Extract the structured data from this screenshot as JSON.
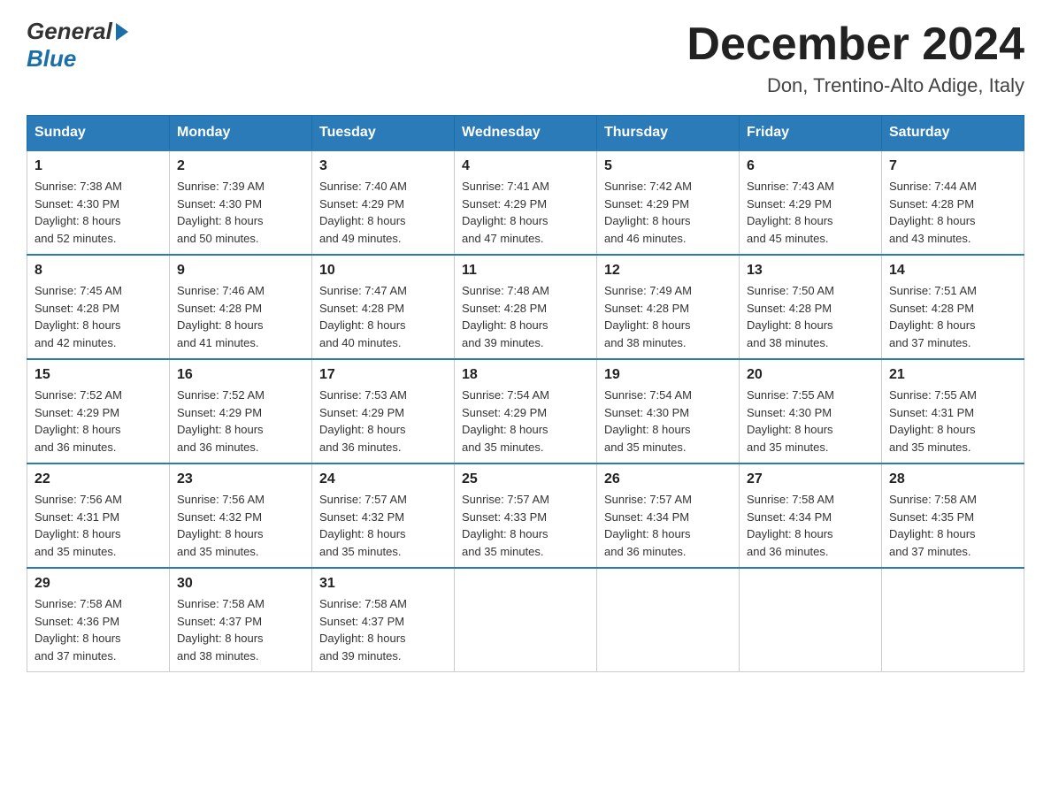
{
  "header": {
    "logo_general": "General",
    "logo_blue": "Blue",
    "month_title": "December 2024",
    "location": "Don, Trentino-Alto Adige, Italy"
  },
  "weekdays": [
    "Sunday",
    "Monday",
    "Tuesday",
    "Wednesday",
    "Thursday",
    "Friday",
    "Saturday"
  ],
  "weeks": [
    [
      {
        "day": "1",
        "sunrise": "7:38 AM",
        "sunset": "4:30 PM",
        "daylight": "8 hours and 52 minutes."
      },
      {
        "day": "2",
        "sunrise": "7:39 AM",
        "sunset": "4:30 PM",
        "daylight": "8 hours and 50 minutes."
      },
      {
        "day": "3",
        "sunrise": "7:40 AM",
        "sunset": "4:29 PM",
        "daylight": "8 hours and 49 minutes."
      },
      {
        "day": "4",
        "sunrise": "7:41 AM",
        "sunset": "4:29 PM",
        "daylight": "8 hours and 47 minutes."
      },
      {
        "day": "5",
        "sunrise": "7:42 AM",
        "sunset": "4:29 PM",
        "daylight": "8 hours and 46 minutes."
      },
      {
        "day": "6",
        "sunrise": "7:43 AM",
        "sunset": "4:29 PM",
        "daylight": "8 hours and 45 minutes."
      },
      {
        "day": "7",
        "sunrise": "7:44 AM",
        "sunset": "4:28 PM",
        "daylight": "8 hours and 43 minutes."
      }
    ],
    [
      {
        "day": "8",
        "sunrise": "7:45 AM",
        "sunset": "4:28 PM",
        "daylight": "8 hours and 42 minutes."
      },
      {
        "day": "9",
        "sunrise": "7:46 AM",
        "sunset": "4:28 PM",
        "daylight": "8 hours and 41 minutes."
      },
      {
        "day": "10",
        "sunrise": "7:47 AM",
        "sunset": "4:28 PM",
        "daylight": "8 hours and 40 minutes."
      },
      {
        "day": "11",
        "sunrise": "7:48 AM",
        "sunset": "4:28 PM",
        "daylight": "8 hours and 39 minutes."
      },
      {
        "day": "12",
        "sunrise": "7:49 AM",
        "sunset": "4:28 PM",
        "daylight": "8 hours and 38 minutes."
      },
      {
        "day": "13",
        "sunrise": "7:50 AM",
        "sunset": "4:28 PM",
        "daylight": "8 hours and 38 minutes."
      },
      {
        "day": "14",
        "sunrise": "7:51 AM",
        "sunset": "4:28 PM",
        "daylight": "8 hours and 37 minutes."
      }
    ],
    [
      {
        "day": "15",
        "sunrise": "7:52 AM",
        "sunset": "4:29 PM",
        "daylight": "8 hours and 36 minutes."
      },
      {
        "day": "16",
        "sunrise": "7:52 AM",
        "sunset": "4:29 PM",
        "daylight": "8 hours and 36 minutes."
      },
      {
        "day": "17",
        "sunrise": "7:53 AM",
        "sunset": "4:29 PM",
        "daylight": "8 hours and 36 minutes."
      },
      {
        "day": "18",
        "sunrise": "7:54 AM",
        "sunset": "4:29 PM",
        "daylight": "8 hours and 35 minutes."
      },
      {
        "day": "19",
        "sunrise": "7:54 AM",
        "sunset": "4:30 PM",
        "daylight": "8 hours and 35 minutes."
      },
      {
        "day": "20",
        "sunrise": "7:55 AM",
        "sunset": "4:30 PM",
        "daylight": "8 hours and 35 minutes."
      },
      {
        "day": "21",
        "sunrise": "7:55 AM",
        "sunset": "4:31 PM",
        "daylight": "8 hours and 35 minutes."
      }
    ],
    [
      {
        "day": "22",
        "sunrise": "7:56 AM",
        "sunset": "4:31 PM",
        "daylight": "8 hours and 35 minutes."
      },
      {
        "day": "23",
        "sunrise": "7:56 AM",
        "sunset": "4:32 PM",
        "daylight": "8 hours and 35 minutes."
      },
      {
        "day": "24",
        "sunrise": "7:57 AM",
        "sunset": "4:32 PM",
        "daylight": "8 hours and 35 minutes."
      },
      {
        "day": "25",
        "sunrise": "7:57 AM",
        "sunset": "4:33 PM",
        "daylight": "8 hours and 35 minutes."
      },
      {
        "day": "26",
        "sunrise": "7:57 AM",
        "sunset": "4:34 PM",
        "daylight": "8 hours and 36 minutes."
      },
      {
        "day": "27",
        "sunrise": "7:58 AM",
        "sunset": "4:34 PM",
        "daylight": "8 hours and 36 minutes."
      },
      {
        "day": "28",
        "sunrise": "7:58 AM",
        "sunset": "4:35 PM",
        "daylight": "8 hours and 37 minutes."
      }
    ],
    [
      {
        "day": "29",
        "sunrise": "7:58 AM",
        "sunset": "4:36 PM",
        "daylight": "8 hours and 37 minutes."
      },
      {
        "day": "30",
        "sunrise": "7:58 AM",
        "sunset": "4:37 PM",
        "daylight": "8 hours and 38 minutes."
      },
      {
        "day": "31",
        "sunrise": "7:58 AM",
        "sunset": "4:37 PM",
        "daylight": "8 hours and 39 minutes."
      },
      null,
      null,
      null,
      null
    ]
  ],
  "labels": {
    "sunrise": "Sunrise:",
    "sunset": "Sunset:",
    "daylight": "Daylight:"
  }
}
